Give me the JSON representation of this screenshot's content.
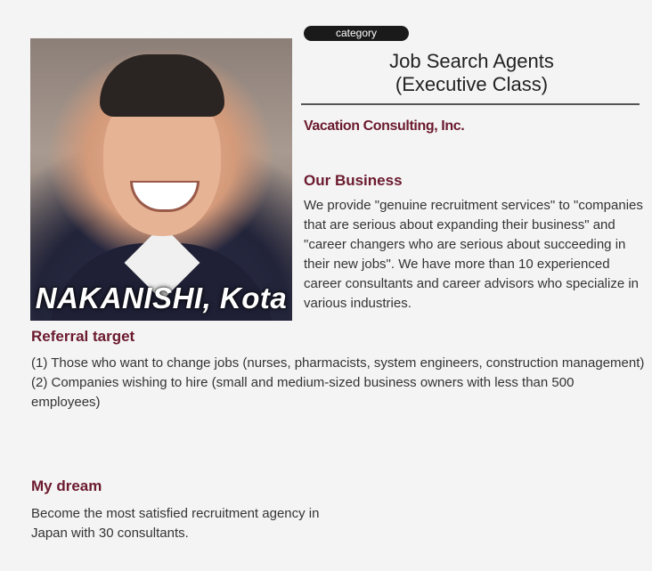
{
  "profile": {
    "name": "NAKANISHI, Kota",
    "category_badge": "category",
    "title_line1": "Job Search Agents",
    "title_line2": "(Executive Class)",
    "company": "Vacation Consulting, Inc."
  },
  "business": {
    "heading": "Our Business",
    "text": "We provide \"genuine recruitment services\" to \"companies that are serious about expanding their business\" and \"career changers who are serious about succeeding in their new jobs\". We have more than 10 experienced career consultants and career advisors who specialize in various industries."
  },
  "referral": {
    "heading": "Referral target",
    "items": [
      "(1) Those who want to change jobs (nurses, pharmacists, system engineers, construction management)",
      "(2) Companies wishing to hire (small and medium-sized business owners with less than 500 employees)"
    ]
  },
  "dream": {
    "heading": "My dream",
    "text": "Become the most satisfied recruitment agency in Japan with 30 consultants."
  },
  "colors": {
    "accent": "#6b1a2e",
    "background": "#f4f4f4"
  }
}
